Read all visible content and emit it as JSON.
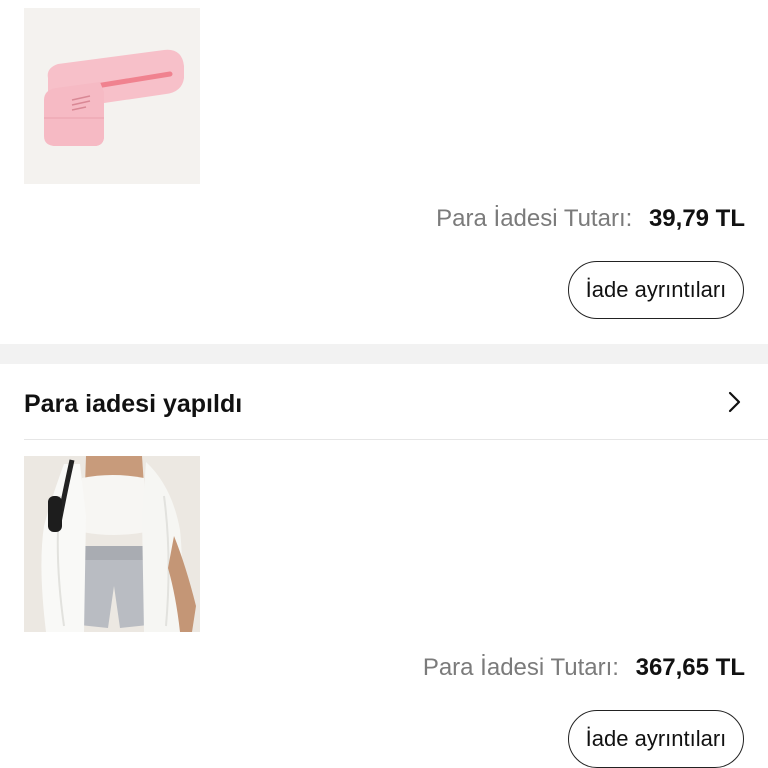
{
  "refunds": [
    {
      "image_icon": "sealer-product-image",
      "amount_label": "Para İadesi Tutarı:",
      "amount_value": "39,79 TL",
      "details_label": "İade ayrıntıları"
    },
    {
      "section_title": "Para iadesi yapıldı",
      "section_icon": "chevron-right-icon",
      "image_icon": "white-shirt-outfit-product-image",
      "amount_label": "Para İadesi Tutarı:",
      "amount_value": "367,65 TL",
      "details_label": "İade ayrıntıları"
    }
  ],
  "colors": {
    "label_gray": "#7b7b7b",
    "divider_band": "#f2f2f2",
    "product_pink": "#f5b3bd"
  }
}
